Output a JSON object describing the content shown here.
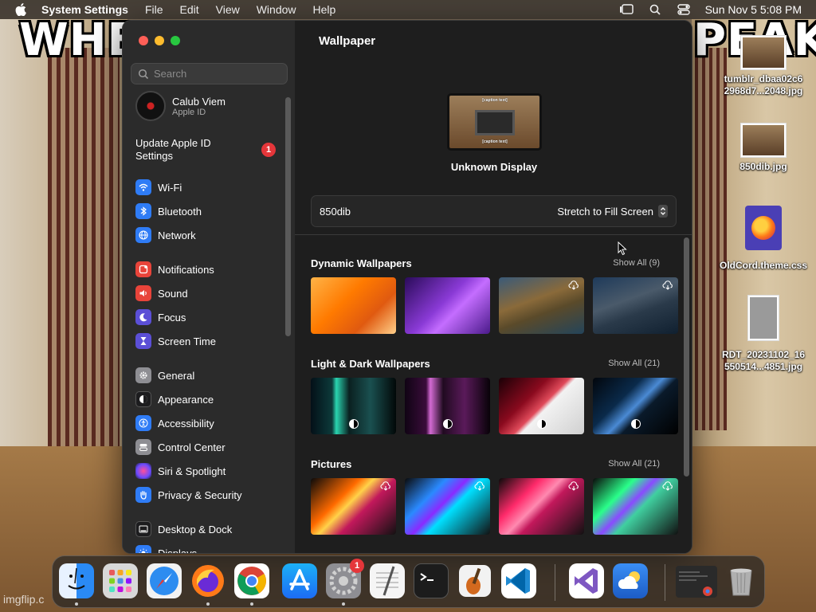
{
  "desktop": {
    "meme_left": "WHE",
    "meme_right": "PEAK",
    "watermark": "imgflip.c",
    "icons": [
      {
        "label": "tumblr_dbaa02c6 2968d7...2048.jpg"
      },
      {
        "label": "850dib.jpg"
      },
      {
        "label": "OldCord.theme.css"
      },
      {
        "label": "RDT_20231102_16 550514...4851.jpg"
      }
    ]
  },
  "menubar": {
    "app_name": "System Settings",
    "items": [
      "File",
      "Edit",
      "View",
      "Window",
      "Help"
    ],
    "clock": "Sun Nov 5  5:08 PM"
  },
  "sidebar": {
    "search_placeholder": "Search",
    "user": {
      "name": "Calub Viem",
      "subtitle": "Apple ID"
    },
    "update": {
      "label": "Update Apple ID Settings",
      "badge": "1"
    },
    "items": [
      {
        "label": "Wi-Fi",
        "color": "#2f7cf6",
        "glyph": "◠"
      },
      {
        "label": "Bluetooth",
        "color": "#2f7cf6",
        "glyph": "ᛒ"
      },
      {
        "label": "Network",
        "color": "#2f7cf6",
        "glyph": "⊕"
      },
      {
        "label": "Notifications",
        "color": "#e8443a",
        "glyph": "▤"
      },
      {
        "label": "Sound",
        "color": "#e8443a",
        "glyph": "◂"
      },
      {
        "label": "Focus",
        "color": "#5b4fd6",
        "glyph": "☾"
      },
      {
        "label": "Screen Time",
        "color": "#5b4fd6",
        "glyph": "⧗"
      },
      {
        "label": "General",
        "color": "#8e8e93",
        "glyph": "⚙"
      },
      {
        "label": "Appearance",
        "color": "#1c1c1e",
        "glyph": "◐"
      },
      {
        "label": "Accessibility",
        "color": "#2f7cf6",
        "glyph": "♿"
      },
      {
        "label": "Control Center",
        "color": "#8e8e93",
        "glyph": "▭"
      },
      {
        "label": "Siri & Spotlight",
        "color": "#b84fd6",
        "glyph": "◉"
      },
      {
        "label": "Privacy & Security",
        "color": "#2f7cf6",
        "glyph": "✋"
      },
      {
        "label": "Desktop & Dock",
        "color": "#1c1c1e",
        "glyph": "▬"
      },
      {
        "label": "Displays",
        "color": "#2f7cf6",
        "glyph": "✺"
      }
    ]
  },
  "main": {
    "title": "Wallpaper",
    "preview_caption": "Unknown Display",
    "preview_text_top": "[caption text]",
    "preview_text_bottom": "[caption text]",
    "file_name": "850dib",
    "fill_mode": "Stretch to Fill Screen",
    "sections": [
      {
        "title": "Dynamic Wallpapers",
        "show_all": "Show All (9)"
      },
      {
        "title": "Light & Dark Wallpapers",
        "show_all": "Show All (21)"
      },
      {
        "title": "Pictures",
        "show_all": "Show All (21)"
      }
    ]
  },
  "dock": {
    "apps": [
      {
        "name": "Finder",
        "color": "#1e88e5"
      },
      {
        "name": "Launchpad",
        "color": "#d0d0d0"
      },
      {
        "name": "Safari",
        "color": "#2d8cf0"
      },
      {
        "name": "Firefox",
        "color": "#ff7a18"
      },
      {
        "name": "Chrome",
        "color": "#ffffff"
      },
      {
        "name": "App Store",
        "color": "#1c8cf5"
      },
      {
        "name": "System Settings",
        "color": "#8e8e93",
        "badge": "1"
      },
      {
        "name": "TextEdit",
        "color": "#f2f2f2"
      },
      {
        "name": "Terminal",
        "color": "#1c1c1c"
      },
      {
        "name": "GarageBand",
        "color": "#e08a2a"
      },
      {
        "name": "Visual Studio Code",
        "color": "#ffffff"
      },
      {
        "name": "Visual Studio",
        "color": "#ffffff"
      },
      {
        "name": "Weather",
        "color": "#2c7be5"
      },
      {
        "name": "Chrome Window",
        "color": "#333333"
      },
      {
        "name": "Trash",
        "color": "#8e8e93"
      }
    ]
  }
}
